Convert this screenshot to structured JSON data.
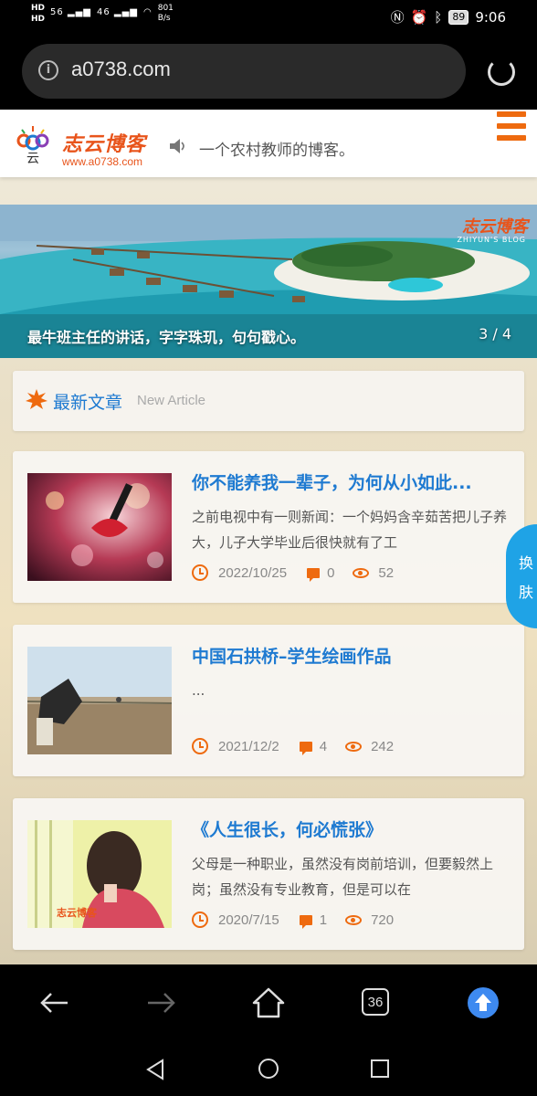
{
  "status_bar": {
    "hd1": "HD",
    "hd2": "HD",
    "signal1": "56",
    "signal2": "46",
    "speed_value": "801",
    "speed_unit": "B/s",
    "battery": "89",
    "time": "9:06"
  },
  "address_bar": {
    "url": "a0738.com",
    "info_icon": "info-icon",
    "reload_icon": "reload-icon"
  },
  "site_header": {
    "logo_title": "志云博客",
    "logo_url": "www.a0738.com",
    "tagline": "一个农村教师的博客。",
    "menu_icon": "hamburger-menu-icon"
  },
  "banner": {
    "caption": "最牛班主任的讲话，字字珠玑，句句戳心。",
    "counter": "3 / 4",
    "watermark_title": "志云博客",
    "watermark_sub": "ZHIYUN'S BLOG"
  },
  "section": {
    "title": "最新文章",
    "subtitle": "New Article"
  },
  "articles": [
    {
      "title": "你不能养我一辈子，为何从小如此...",
      "excerpt": "之前电视中有一则新闻：一个妈妈含辛茹苦把儿子养大，儿子大学毕业后很快就有了工",
      "date": "2022/10/25",
      "comments": "0",
      "views": "52"
    },
    {
      "title": "中国石拱桥–学生绘画作品",
      "excerpt": "...",
      "date": "2021/12/2",
      "comments": "4",
      "views": "242"
    },
    {
      "title": "《人生很长，何必慌张》",
      "excerpt": "父母是一种职业，虽然没有岗前培训，但要毅然上岗；虽然没有专业教育，但是可以在",
      "date": "2020/7/15",
      "comments": "1",
      "views": "720"
    }
  ],
  "skin_switch": {
    "char1": "换",
    "char2": "肤"
  },
  "toolbar": {
    "tab_count": "36"
  },
  "colors": {
    "accent_orange": "#ee6a0f",
    "link_blue": "#1e7ad1",
    "skin_blue": "#1fa3e6",
    "upload_blue": "#3e8af0"
  }
}
